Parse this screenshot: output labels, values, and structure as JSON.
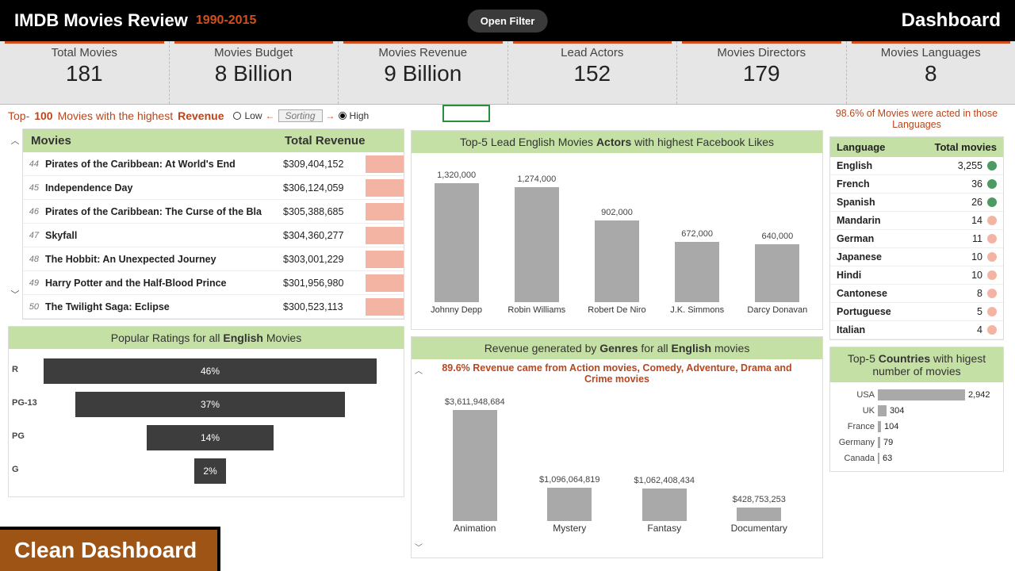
{
  "header": {
    "title": "IMDB Movies Review",
    "years": "1990-2015",
    "open_filter": "Open Filter",
    "dashboard": "Dashboard"
  },
  "kpis": [
    {
      "label": "Total Movies",
      "value": "181"
    },
    {
      "label": "Movies Budget",
      "value": "8 Billion"
    },
    {
      "label": "Movies Revenue",
      "value": "9 Billion"
    },
    {
      "label": "Lead Actors",
      "value": "152"
    },
    {
      "label": "Movies Directors",
      "value": "179"
    },
    {
      "label": "Movies Languages",
      "value": "8"
    }
  ],
  "top100": {
    "banner_pre": "Top-",
    "banner_n": "100",
    "banner_mid": " Movies with the highest ",
    "banner_metric": "Revenue",
    "low": "Low",
    "high": "High",
    "sorting": "Sorting",
    "head_movie": "Movies",
    "head_rev": "Total Revenue",
    "rows": [
      {
        "rank": "44",
        "title": "Pirates of the Caribbean: At World's End",
        "rev": "$309,404,152"
      },
      {
        "rank": "45",
        "title": "Independence Day",
        "rev": "$306,124,059"
      },
      {
        "rank": "46",
        "title": "Pirates of the Caribbean: The Curse of the Bla",
        "rev": "$305,388,685"
      },
      {
        "rank": "47",
        "title": "Skyfall",
        "rev": "$304,360,277"
      },
      {
        "rank": "48",
        "title": "The Hobbit: An Unexpected Journey",
        "rev": "$303,001,229"
      },
      {
        "rank": "49",
        "title": "Harry Potter and the Half-Blood Prince",
        "rev": "$301,956,980"
      },
      {
        "rank": "50",
        "title": "The Twilight Saga: Eclipse",
        "rev": "$300,523,113"
      }
    ]
  },
  "ratings": {
    "title_pre": "Popular Ratings for all ",
    "title_b": "English",
    "title_post": " Movies"
  },
  "actors": {
    "title_pre": "Top-5 Lead English Movies ",
    "title_b": "Actors",
    "title_post": " with highest Facebook Likes"
  },
  "genres": {
    "title_pre": "Revenue generated by ",
    "title_b1": "Genres",
    "title_mid": " for all ",
    "title_b2": "English",
    "title_post": " movies",
    "note": "89.6% Revenue came from Action movies, Comedy, Adventure, Drama and Crime movies"
  },
  "languages": {
    "note": "98.6% of Movies were acted in those Languages",
    "head_lang": "Language",
    "head_tot": "Total movies",
    "rows": [
      {
        "lang": "English",
        "count": "3,255",
        "dot": "green"
      },
      {
        "lang": "French",
        "count": "36",
        "dot": "green"
      },
      {
        "lang": "Spanish",
        "count": "26",
        "dot": "green"
      },
      {
        "lang": "Mandarin",
        "count": "14",
        "dot": "pink"
      },
      {
        "lang": "German",
        "count": "11",
        "dot": "pink"
      },
      {
        "lang": "Japanese",
        "count": "10",
        "dot": "pink"
      },
      {
        "lang": "Hindi",
        "count": "10",
        "dot": "pink"
      },
      {
        "lang": "Cantonese",
        "count": "8",
        "dot": "pink"
      },
      {
        "lang": "Portuguese",
        "count": "5",
        "dot": "pink"
      },
      {
        "lang": "Italian",
        "count": "4",
        "dot": "pink"
      }
    ]
  },
  "countries": {
    "title_pre": "Top-5 ",
    "title_b": "Countries",
    "title_post": " with higest number of movies"
  },
  "footer_badge": "Clean Dashboard",
  "chart_data": [
    {
      "type": "bar",
      "title": "Top-5 Lead English Movies Actors with highest Facebook Likes",
      "categories": [
        "Johnny Depp",
        "Robin Williams",
        "Robert De Niro",
        "J.K. Simmons",
        "Darcy Donavan"
      ],
      "values": [
        1320000,
        1274000,
        902000,
        672000,
        640000
      ],
      "value_labels": [
        "1,320,000",
        "1,274,000",
        "902,000",
        "672,000",
        "640,000"
      ],
      "ylabel": "Facebook Likes"
    },
    {
      "type": "bar",
      "title": "Popular Ratings for all English Movies",
      "orientation": "horizontal-funnel",
      "categories": [
        "R",
        "PG-13",
        "PG",
        "G"
      ],
      "values": [
        46,
        37,
        14,
        2
      ],
      "value_labels": [
        "46%",
        "37%",
        "14%",
        "2%"
      ]
    },
    {
      "type": "bar",
      "title": "Revenue generated by Genres for all English movies",
      "categories": [
        "Animation",
        "Mystery",
        "Fantasy",
        "Documentary"
      ],
      "values": [
        3611948684,
        1096064819,
        1062408434,
        428753253
      ],
      "value_labels": [
        "$3,611,948,684",
        "$1,096,064,819",
        "$1,062,408,434",
        "$428,753,253"
      ],
      "note": "89.6% Revenue came from Action movies, Comedy, Adventure, Drama and Crime movies"
    },
    {
      "type": "bar",
      "title": "Top-5 Countries with higest number of movies",
      "orientation": "horizontal",
      "categories": [
        "USA",
        "UK",
        "France",
        "Germany",
        "Canada"
      ],
      "values": [
        2942,
        304,
        104,
        79,
        63
      ],
      "value_labels": [
        "2,942",
        "304",
        "104",
        "79",
        "63"
      ]
    }
  ]
}
